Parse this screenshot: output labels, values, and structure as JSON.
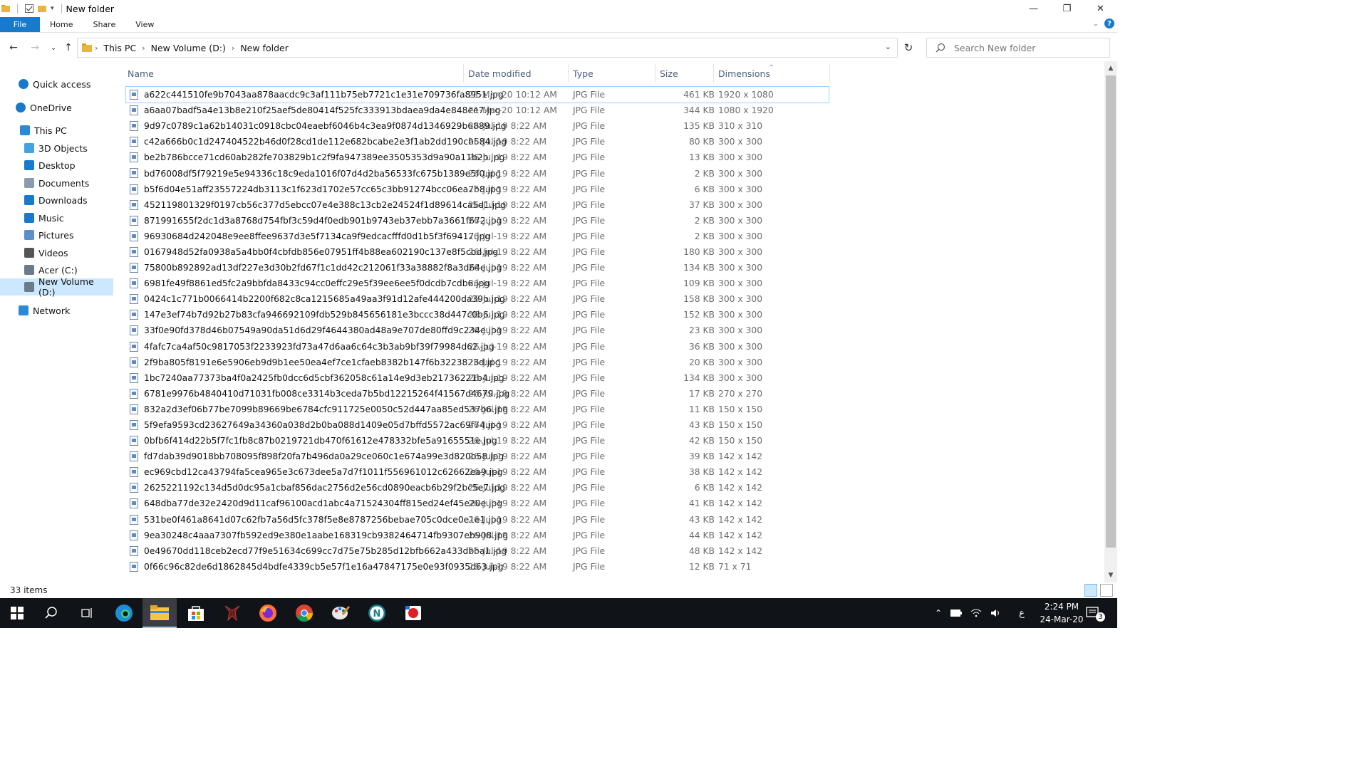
{
  "window": {
    "title": "New folder",
    "controls": {
      "minimize": "—",
      "maximize": "❐",
      "close": "✕"
    }
  },
  "ribbon": {
    "tabs": [
      "File",
      "Home",
      "Share",
      "View"
    ]
  },
  "address": {
    "crumbs": [
      "This PC",
      "New Volume (D:)",
      "New folder"
    ],
    "search_placeholder": "Search New folder"
  },
  "nav": {
    "items": [
      {
        "label": "Quick access",
        "icon": "star-icon"
      },
      {
        "label": "OneDrive",
        "icon": "cloud-icon"
      },
      {
        "label": "This PC",
        "icon": "computer-icon"
      },
      {
        "label": "3D Objects",
        "icon": "cube-icon"
      },
      {
        "label": "Desktop",
        "icon": "desktop-icon"
      },
      {
        "label": "Documents",
        "icon": "documents-icon"
      },
      {
        "label": "Downloads",
        "icon": "download-icon"
      },
      {
        "label": "Music",
        "icon": "music-icon"
      },
      {
        "label": "Pictures",
        "icon": "pictures-icon"
      },
      {
        "label": "Videos",
        "icon": "videos-icon"
      },
      {
        "label": "Acer (C:)",
        "icon": "drive-icon"
      },
      {
        "label": "New Volume (D:)",
        "icon": "drive-icon",
        "selected": true
      },
      {
        "label": "Network",
        "icon": "network-icon"
      }
    ]
  },
  "columns": {
    "name": "Name",
    "date": "Date modified",
    "type": "Type",
    "size": "Size",
    "dims": "Dimensions"
  },
  "files": [
    {
      "name": "a622c441510fe9b7043aa878aacdc9c3af111b75eb7721c1e31e709736fa8951.jpg",
      "date": "21-Mar-20 10:12 AM",
      "type": "JPG File",
      "size": "461 KB",
      "dims": "1920 x 1080"
    },
    {
      "name": "a6aa07badf5a4e13b8e210f25aef5de80414f525fc333913bdaea9da4e848ee7.jpg",
      "date": "21-Mar-20 10:12 AM",
      "type": "JPG File",
      "size": "344 KB",
      "dims": "1080 x 1920"
    },
    {
      "name": "9d97c0789c1a62b14031c0918cbc04eaebf6046b4c3ea9f0874d1346929b6889.jpg",
      "date": "26-Jul-19 8:22 AM",
      "type": "JPG File",
      "size": "135 KB",
      "dims": "310 x 310"
    },
    {
      "name": "c42a666b0c1d247404522b46d0f28cd1de112e682bcabe2e3f1ab2dd190cb584.jpg",
      "date": "26-Jul-19 8:22 AM",
      "type": "JPG File",
      "size": "80 KB",
      "dims": "300 x 300"
    },
    {
      "name": "be2b786bcce71cd60ab282fe703829b1c2f9fa947389ee3505353d9a90a11b2b.jpg",
      "date": "26-Jul-19 8:22 AM",
      "type": "JPG File",
      "size": "13 KB",
      "dims": "300 x 300"
    },
    {
      "name": "bd76008df5f79219e5e94336c18c9eda1016f07d4d2ba56533fc675b1389e5f0.jpg",
      "date": "26-Jul-19 8:22 AM",
      "type": "JPG File",
      "size": "2 KB",
      "dims": "300 x 300"
    },
    {
      "name": "b5f6d04e51aff23557224db3113c1f623d1702e57cc65c3bb91274bcc06ea7b8.jpg",
      "date": "26-Jul-19 8:22 AM",
      "type": "JPG File",
      "size": "6 KB",
      "dims": "300 x 300"
    },
    {
      "name": "452119801329f0197cb56c377d5ebcc07e4e388c13cb2e24524f1d89614ca5d1.jpg",
      "date": "26-Jul-19 8:22 AM",
      "type": "JPG File",
      "size": "37 KB",
      "dims": "300 x 300"
    },
    {
      "name": "871991655f2dc1d3a8768d754fbf3c59d4f0edb901b9743eb37ebb7a3661f672.jpg",
      "date": "26-Jul-19 8:22 AM",
      "type": "JPG File",
      "size": "2 KB",
      "dims": "300 x 300"
    },
    {
      "name": "96930684d242048e9ee8ffee9637d3e5f7134ca9f9edcacfffd0d1b5f3f69417.jpg",
      "date": "26-Jul-19 8:22 AM",
      "type": "JPG File",
      "size": "2 KB",
      "dims": "300 x 300"
    },
    {
      "name": "0167948d52fa0938a5a4bb0f4cbfdb856e07951ff4b88ea602190c137e8f5cbd.jpg",
      "date": "26-Jul-19 8:22 AM",
      "type": "JPG File",
      "size": "180 KB",
      "dims": "300 x 300"
    },
    {
      "name": "75800b892892ad13df227e3d30b2fd67f1c1dd42c212061f33a38882f8a3d64e.jpg",
      "date": "26-Jul-19 8:22 AM",
      "type": "JPG File",
      "size": "134 KB",
      "dims": "300 x 300"
    },
    {
      "name": "6981fe49f8861ed5fc2a9bbfda8433c94cc0effc29e5f39ee6ee5f0dcdb7cdb6.jpg",
      "date": "26-Jul-19 8:22 AM",
      "type": "JPG File",
      "size": "109 KB",
      "dims": "300 x 300"
    },
    {
      "name": "0424c1c771b0066414b2200f682c8ca1215685a49aa3f91d12afe444200da39b.jpg",
      "date": "26-Jul-19 8:22 AM",
      "type": "JPG File",
      "size": "158 KB",
      "dims": "300 x 300"
    },
    {
      "name": "147e3ef74b7d92b27b83cfa946692109fdb529b845656181e3bccc38d447c0b6.jpg",
      "date": "26-Jul-19 8:22 AM",
      "type": "JPG File",
      "size": "152 KB",
      "dims": "300 x 300"
    },
    {
      "name": "33f0e90fd378d46b07549a90da51d6d29f4644380ad48a9e707de80ffd9c234e.jpg",
      "date": "26-Jul-19 8:22 AM",
      "type": "JPG File",
      "size": "23 KB",
      "dims": "300 x 300"
    },
    {
      "name": "4fafc7ca4af50c9817053f2233923fd73a47d6aa6c64c3b3ab9bf39f79984d62.jpg",
      "date": "26-Jul-19 8:22 AM",
      "type": "JPG File",
      "size": "36 KB",
      "dims": "300 x 300"
    },
    {
      "name": "2f9ba805f8191e6e5906eb9d9b1ee50ea4ef7ce1cfaeb8382b147f6b3223823d.jpg",
      "date": "26-Jul-19 8:22 AM",
      "type": "JPG File",
      "size": "20 KB",
      "dims": "300 x 300"
    },
    {
      "name": "1bc7240aa77373ba4f0a2425fb0dcc6d5cbf362058c61a14e9d3eb21736221b4.jpg",
      "date": "26-Jul-19 8:22 AM",
      "type": "JPG File",
      "size": "134 KB",
      "dims": "300 x 300"
    },
    {
      "name": "6781e9976b4840410d71031fb008ce3314b3ceda7b5bd12215264f41567d4679.jpg",
      "date": "26-Jul-19 8:22 AM",
      "type": "JPG File",
      "size": "17 KB",
      "dims": "270 x 270"
    },
    {
      "name": "832a2d3ef06b77be7099b89669be6784cfc911725e0050c52d447aa85ed537b6.jpg",
      "date": "26-Jul-19 8:22 AM",
      "type": "JPG File",
      "size": "11 KB",
      "dims": "150 x 150"
    },
    {
      "name": "5f9efa9593cd23627649a34360a038d2b0ba088d1409e05d7bffd5572ac69f74.jpg",
      "date": "26-Jul-19 8:22 AM",
      "type": "JPG File",
      "size": "43 KB",
      "dims": "150 x 150"
    },
    {
      "name": "0bfb6f414d22b5f7fc1fb8c87b0219721db470f61612e478332bfe5a9165551e.jpg",
      "date": "26-Jul-19 8:22 AM",
      "type": "JPG File",
      "size": "42 KB",
      "dims": "150 x 150"
    },
    {
      "name": "fd7dab39d9018bb708095f898f20fa7b496da0a29ce060c1e674a99e3d820b58.jpg",
      "date": "26-Jul-19 8:22 AM",
      "type": "JPG File",
      "size": "39 KB",
      "dims": "142 x 142"
    },
    {
      "name": "ec969cbd12ca43794fa5cea965e3c673dee5a7d7f1011f556961012c62662ea9.jpg",
      "date": "26-Jul-19 8:22 AM",
      "type": "JPG File",
      "size": "38 KB",
      "dims": "142 x 142"
    },
    {
      "name": "2625221192c134d5d0dc95a1cbaf856dac2756d2e56cd0890eacb6b29f2bc5e7.jpg",
      "date": "26-Jul-19 8:22 AM",
      "type": "JPG File",
      "size": "6 KB",
      "dims": "142 x 142"
    },
    {
      "name": "648dba77de32e2420d9d11caf96100acd1abc4a71524304ff815ed24ef45e20e.jpg",
      "date": "26-Jul-19 8:22 AM",
      "type": "JPG File",
      "size": "41 KB",
      "dims": "142 x 142"
    },
    {
      "name": "531be0f461a8641d07c62fb7a56d5fc378f5e8e8787256bebae705c0dce0e1e1.jpg",
      "date": "26-Jul-19 8:22 AM",
      "type": "JPG File",
      "size": "43 KB",
      "dims": "142 x 142"
    },
    {
      "name": "9ea30248c4aaa7307fb592ed9e380e1aabe168319cb9382464714fb9307eb908.jpg",
      "date": "26-Jul-19 8:22 AM",
      "type": "JPG File",
      "size": "44 KB",
      "dims": "142 x 142"
    },
    {
      "name": "0e49670dd118ceb2ecd77f9e51634c699cc7d75e75b285d12bfb662a433dbba1.jpg",
      "date": "26-Jul-19 8:22 AM",
      "type": "JPG File",
      "size": "48 KB",
      "dims": "142 x 142"
    },
    {
      "name": "0f66c96c82de6d1862845d4bdfe4339cb5e57f1e16a47847175e0e93f0935d63.jpg",
      "date": "26-Jul-19 8:22 AM",
      "type": "JPG File",
      "size": "12 KB",
      "dims": "71 x 71"
    }
  ],
  "status": {
    "count": "33 items"
  },
  "taskbar": {
    "time": "2:24 PM",
    "date": "24-Mar-20",
    "lang": "ع",
    "notif_count": "3"
  }
}
